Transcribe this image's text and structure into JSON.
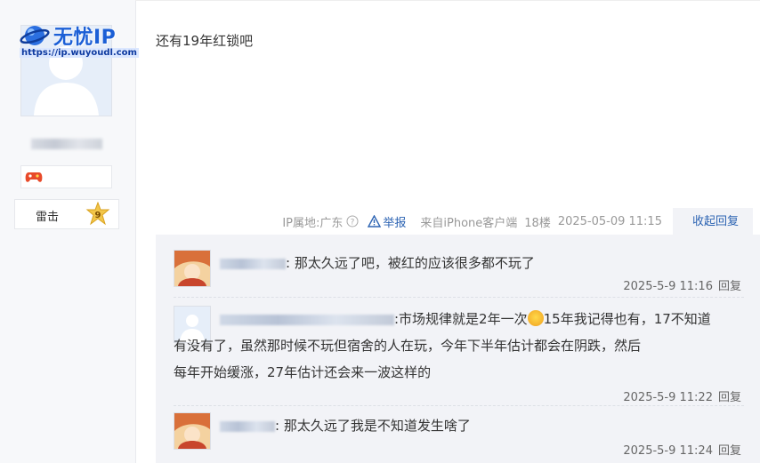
{
  "watermark": {
    "title": "无忧IP",
    "url": "https://ip.wuyoudl.com"
  },
  "user": {
    "rank_name": "雷击",
    "rank_level": "9"
  },
  "post": {
    "content": "还有19年红锁吧"
  },
  "meta": {
    "ip_label": "IP属地:广东",
    "report": "举报",
    "source": "来自iPhone客户端",
    "floor": "18楼",
    "time": "2025-05-09 11:15",
    "collapse": "收起回复"
  },
  "replies": [
    {
      "text": ": 那太久远了吧，被红的应该很多都不玩了",
      "time": "2025-5-9 11:16",
      "reply_label": "回复"
    },
    {
      "text_before_emoji": ":市场规律就是2年一次",
      "text_after_emoji": "15年我记得也有，17不知道",
      "text_line2": "有没有了，虽然那时候不玩但宿舍的人在玩，今年下半年估计都会在阴跌，然后",
      "text_line3": "每年开始缓涨，27年估计还会来一波这样的",
      "time": "2025-5-9 11:22",
      "reply_label": "回复"
    },
    {
      "text": ": 那太久远了我是不知道发生啥了",
      "time": "2025-5-9 11:24",
      "reply_label": "回复"
    }
  ],
  "colors": {
    "accent": "#2d64b3",
    "sub_bg": "#f2f3f7"
  },
  "icons": [
    "game-controller-icon",
    "help-circle-icon",
    "warning-icon",
    "rank-star-icon",
    "emoji-icon"
  ]
}
